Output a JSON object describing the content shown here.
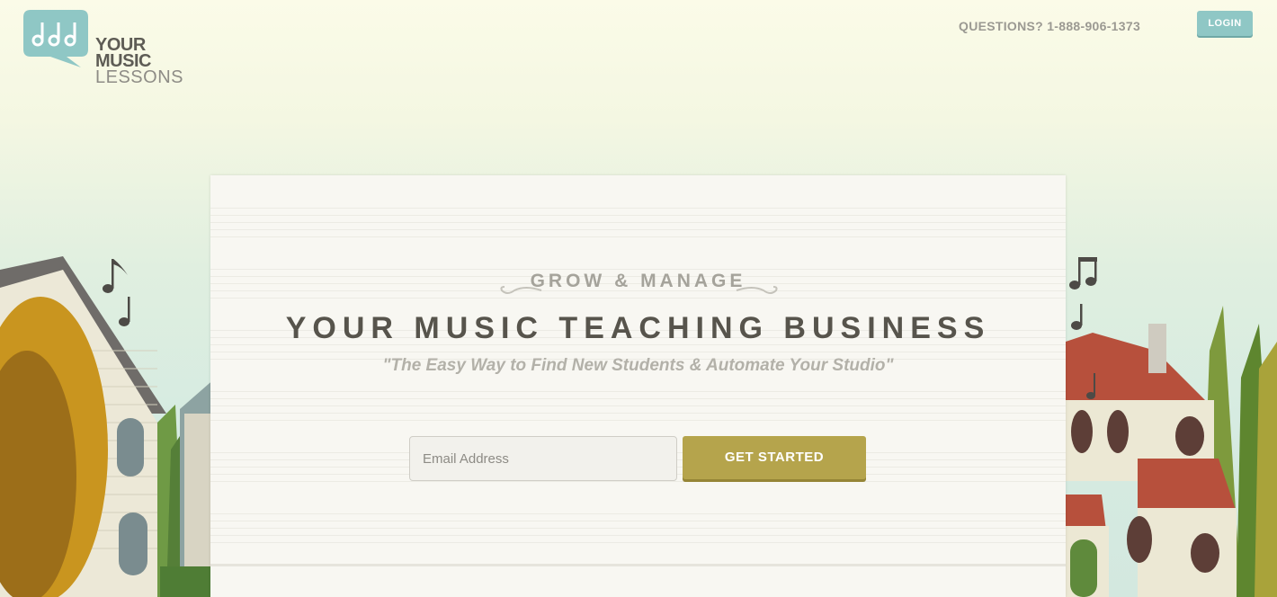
{
  "brand": {
    "line1": "YOUR",
    "line2": "MUSIC",
    "line3": "LESSONS"
  },
  "header": {
    "questions": "QUESTIONS? 1-888-906-1373",
    "login_label": "LOGIN"
  },
  "hero": {
    "eyebrow": "GROW & MANAGE",
    "headline": "YOUR MUSIC TEACHING BUSINESS",
    "tagline": "\"The Easy Way to Find New Students & Automate Your Studio\"",
    "email_placeholder": "Email Address",
    "cta_label": "GET STARTED"
  },
  "colors": {
    "teal": "#8fc7c5",
    "gold": "#b5a44c",
    "text_dark": "#57544c"
  }
}
